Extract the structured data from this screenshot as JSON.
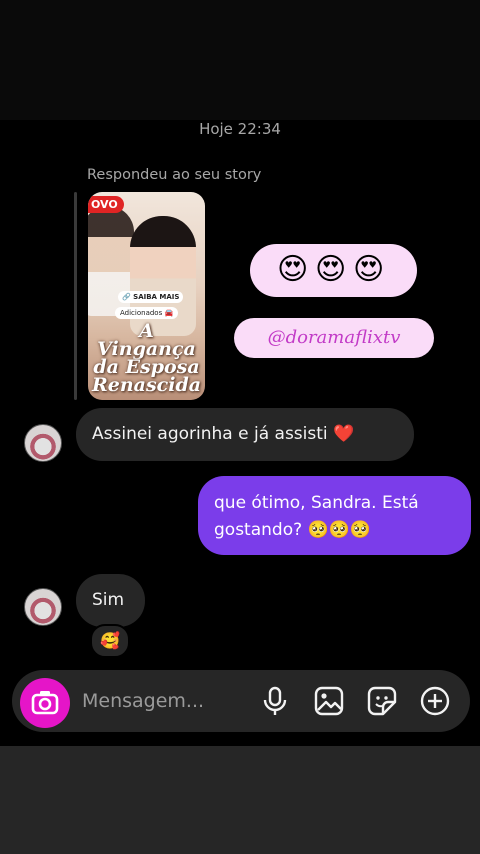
{
  "chat": {
    "timestamp": "Hoje 22:34",
    "reply_label": "Respondeu ao seu story",
    "story": {
      "badge": "OVO",
      "saiba_mais": "SAIBA MAIS",
      "adicionados": "Adicionados",
      "title_line1": "A Vingança",
      "title_line2": "da Esposa",
      "title_line3": "Renascida"
    },
    "emoji_reaction": [
      "😍",
      "😍",
      "😍"
    ],
    "mention": "@doramaflixtv",
    "messages": [
      {
        "side": "in",
        "text": "Assinei  agorinha e já assisti ❤️"
      },
      {
        "side": "out",
        "line1": "que ótimo, Sandra. Está",
        "line2": "gostando? 🥺🥺🥺"
      },
      {
        "side": "in",
        "text": "Sim"
      }
    ],
    "reaction_emoji": "🥰"
  },
  "composer": {
    "placeholder": "Mensagem..."
  },
  "icons": {
    "camera": "camera-icon",
    "mic": "microphone-icon",
    "gallery": "gallery-icon",
    "sticker": "sticker-icon",
    "plus": "plus-circle-icon"
  },
  "colors": {
    "background": "#000000",
    "incoming_bubble": "#262626",
    "outgoing_bubble": "#7b3dea",
    "pink_bubble": "#fadcf8",
    "camera_button": "#e515c8"
  }
}
